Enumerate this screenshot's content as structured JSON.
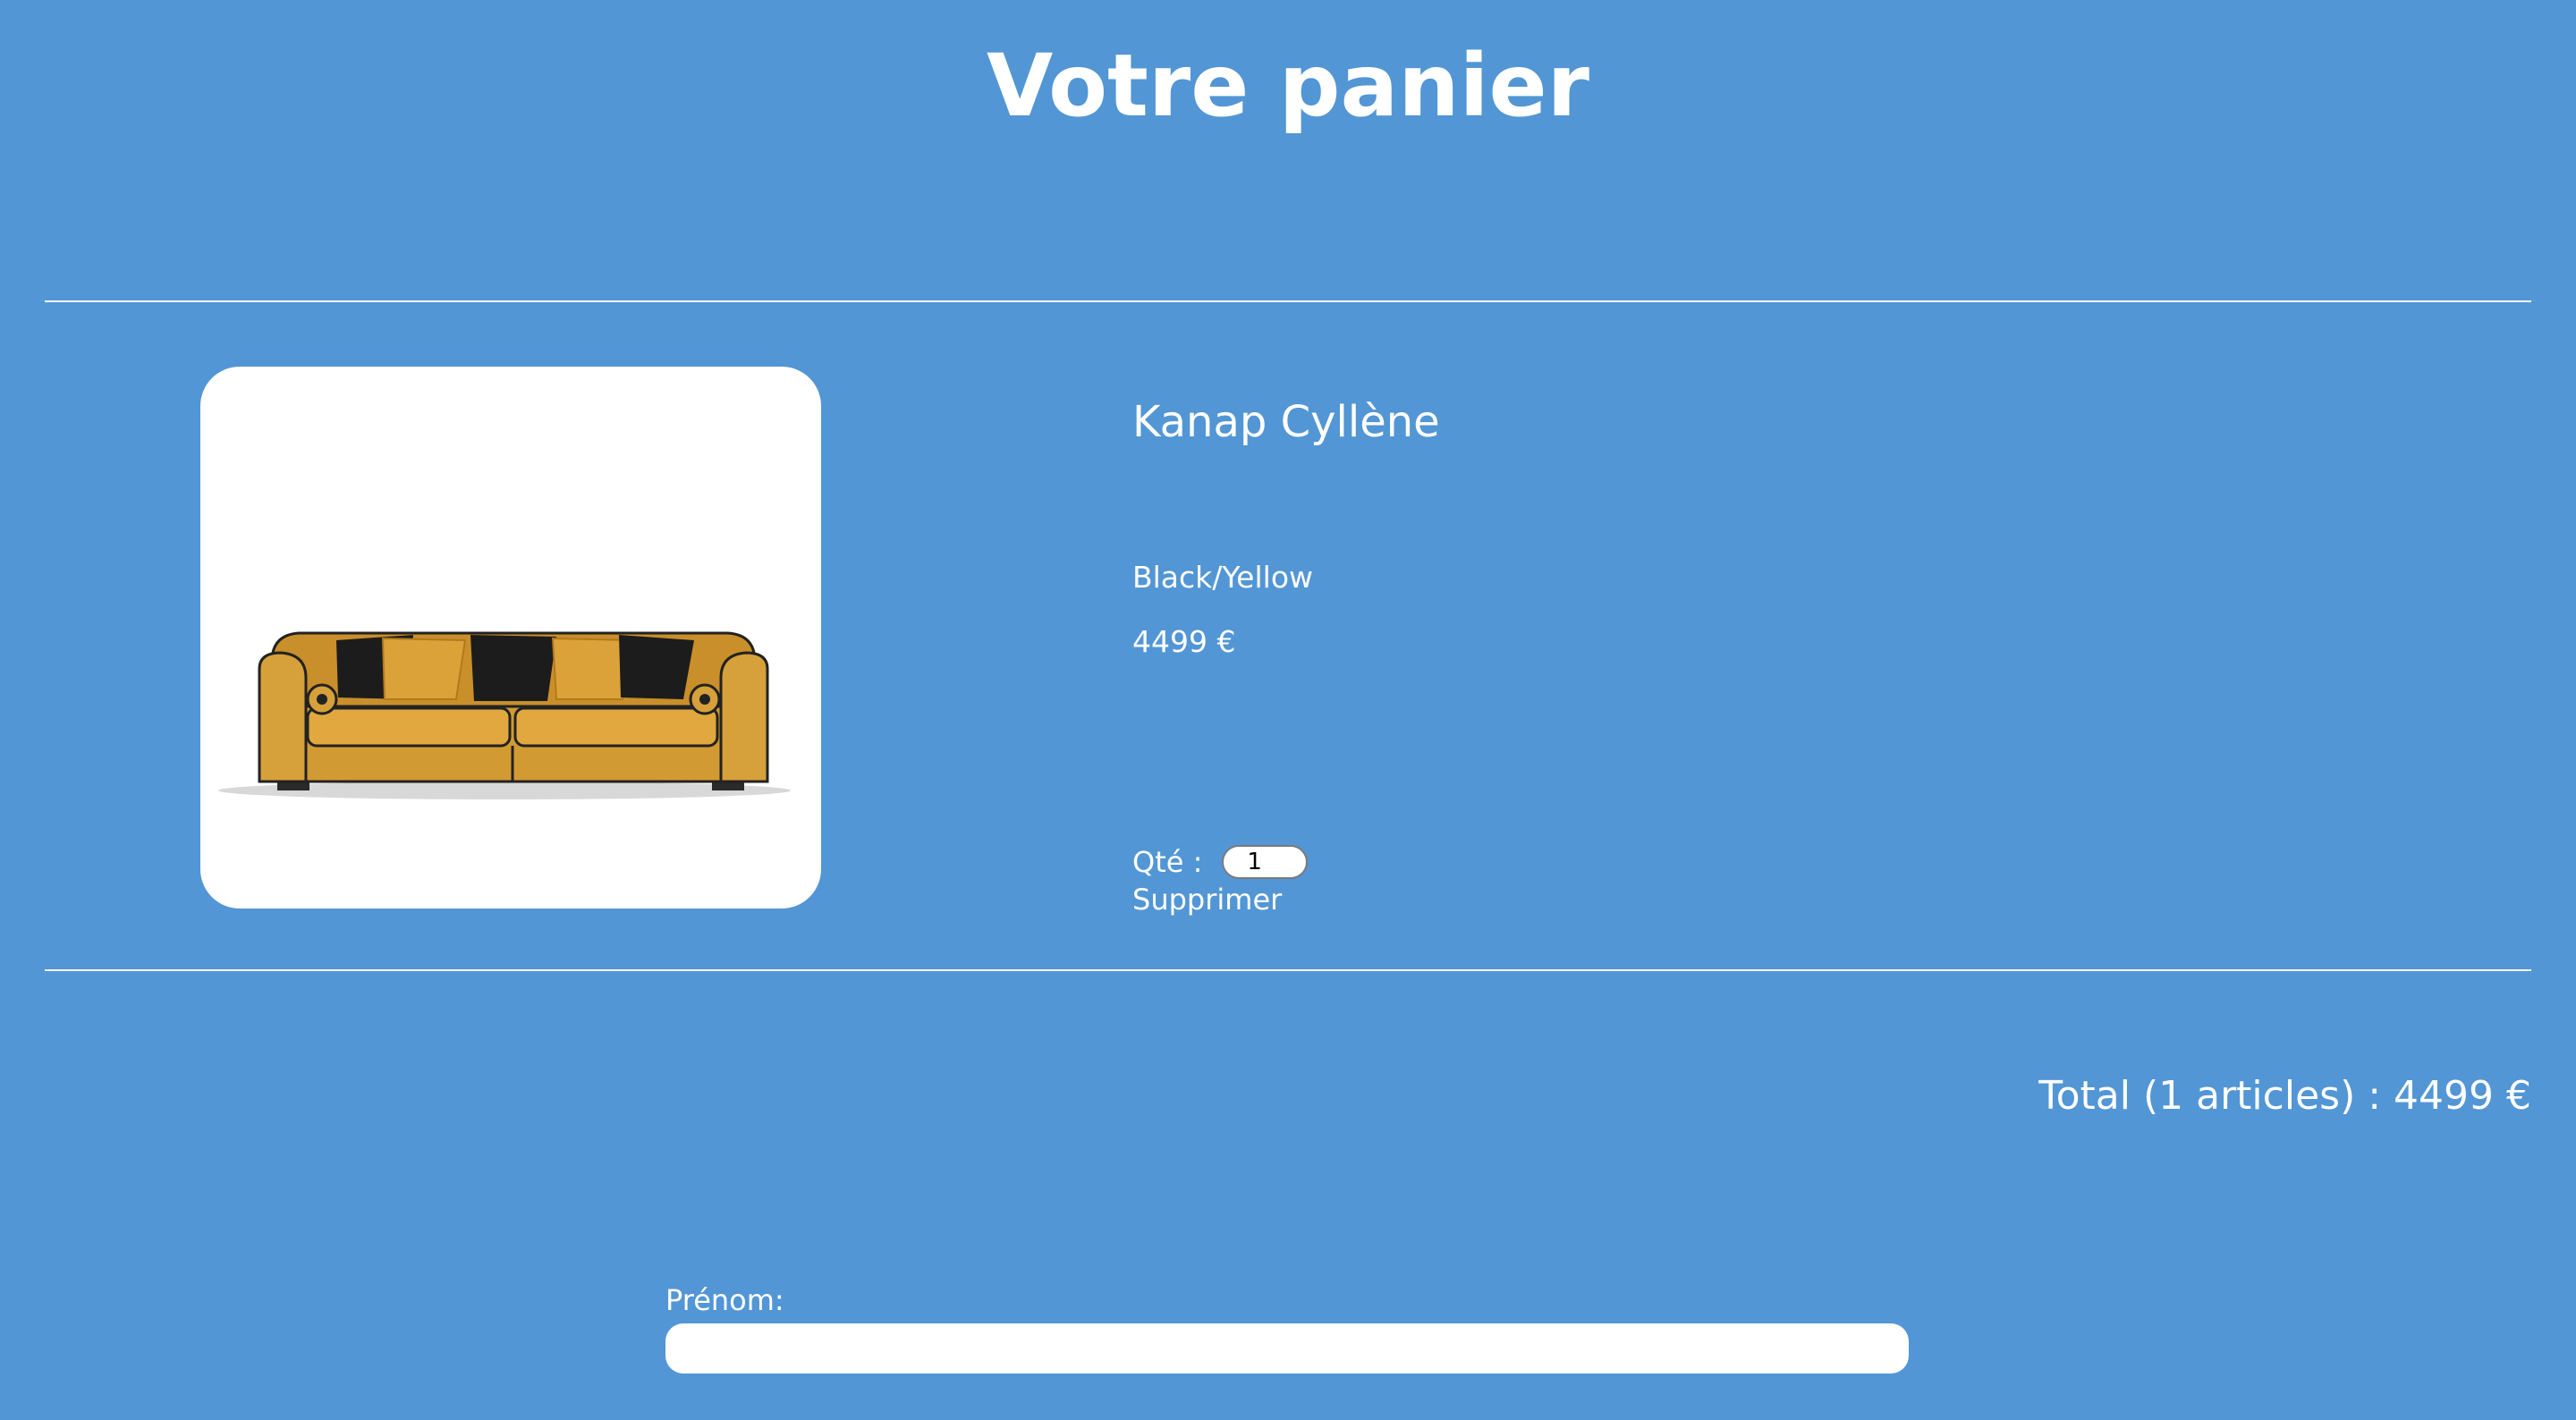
{
  "page": {
    "title": "Votre panier"
  },
  "cart": {
    "items": [
      {
        "name": "Kanap Cyllène",
        "color": "Black/Yellow",
        "price": "4499 €",
        "quantity_label": "Qté :",
        "quantity": "1",
        "delete_label": "Supprimer",
        "image_subject": "yellow sofa with black and yellow cushions"
      }
    ]
  },
  "summary": {
    "total_prefix": "Total (",
    "total_count": "1",
    "total_middle": " articles) : ",
    "total_price": "4499",
    "total_suffix": " €"
  },
  "form": {
    "first_name_label": "Prénom:",
    "first_name_value": ""
  },
  "colors": {
    "background": "#5296d5",
    "text": "#ffffff",
    "sofa": "#d9a23a",
    "cushion_dark": "#1a1a1a"
  }
}
